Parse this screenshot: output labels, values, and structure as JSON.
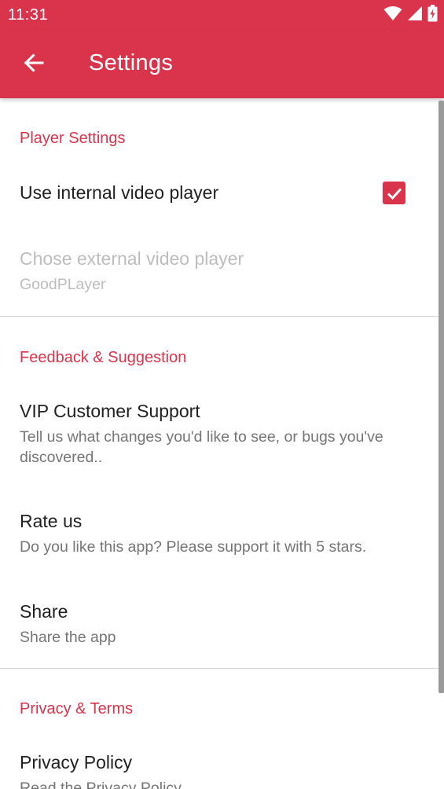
{
  "status_bar": {
    "time": "11:31",
    "icons": [
      "wifi-icon",
      "cellular-signal-icon",
      "battery-charging-icon"
    ]
  },
  "app_bar": {
    "back_icon": "arrow-left-icon",
    "title": "Settings"
  },
  "colors": {
    "accent": "#d9344c",
    "title_text": "#212121",
    "summary_text": "#757575",
    "disabled_text": "#bdbdbd",
    "divider": "#d6d6d6"
  },
  "sections": [
    {
      "category": "Player Settings",
      "items": [
        {
          "title": "Use internal video player",
          "checked": true
        },
        {
          "title": "Chose external video player",
          "summary": "GoodPLayer",
          "enabled": false
        }
      ]
    },
    {
      "category": "Feedback & Suggestion",
      "items": [
        {
          "title": "VIP Customer Support",
          "summary": "Tell us what changes you'd like to see, or bugs you've discovered.."
        },
        {
          "title": "Rate us",
          "summary": "Do you like this app? Please support it with 5 stars."
        },
        {
          "title": "Share",
          "summary": "Share the app"
        }
      ]
    },
    {
      "category": "Privacy & Terms",
      "items": [
        {
          "title": "Privacy Policy",
          "summary": "Read the Privacy Policy"
        }
      ]
    }
  ]
}
